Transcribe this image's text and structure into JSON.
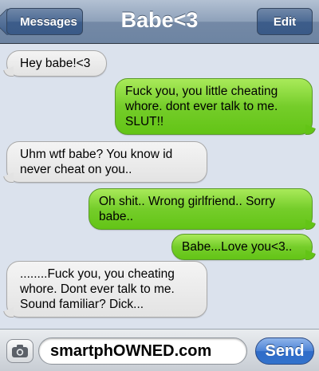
{
  "header": {
    "back_label": "Messages",
    "title": "Babe<3",
    "edit_label": "Edit"
  },
  "messages": [
    {
      "direction": "received",
      "text": "Hey babe!<3"
    },
    {
      "direction": "sent",
      "text": "Fuck you, you little cheating whore. dont ever talk to me. SLUT!!"
    },
    {
      "direction": "received",
      "text": "Uhm wtf babe? You know id never cheat on you.."
    },
    {
      "direction": "sent",
      "text": "Oh shit.. Wrong girlfriend.. Sorry babe.."
    },
    {
      "direction": "sent",
      "text": "Babe...Love you<3.."
    },
    {
      "direction": "received",
      "text": "........Fuck you,  you cheating whore. Dont ever talk to me. Sound familiar? Dick..."
    }
  ],
  "input": {
    "value": "smartphOWNED.com",
    "send_label": "Send"
  },
  "icons": {
    "camera": "camera-icon",
    "back": "chevron-left-icon"
  },
  "colors": {
    "sent_bubble": "#75cd2a",
    "received_bubble": "#e8e8e8",
    "navbar": "#8ea1ba",
    "send_button": "#3373cc"
  }
}
